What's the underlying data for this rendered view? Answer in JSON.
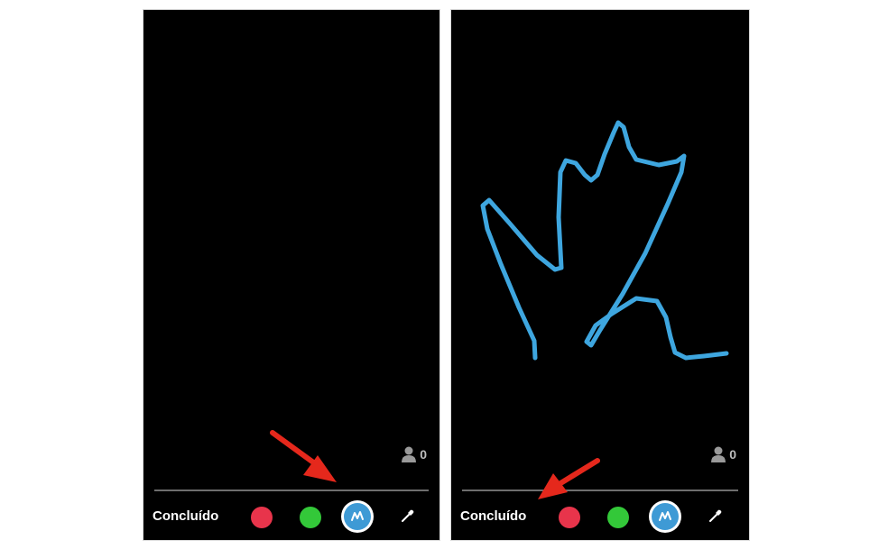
{
  "colors": {
    "background": "#000000",
    "red_color": "#e8344b",
    "green_color": "#33c839",
    "pen_blue": "#3e9ad5",
    "drawing_stroke": "#3ea6df",
    "annotation_arrow": "#e5281c"
  },
  "left_screen": {
    "viewer_icon": "person-icon",
    "viewer_count": "0",
    "done_label": "Concluído",
    "tools": [
      "red-color",
      "green-color",
      "pen-icon",
      "eyedropper-icon"
    ]
  },
  "right_screen": {
    "viewer_icon": "person-icon",
    "viewer_count": "0",
    "done_label": "Concluído",
    "tools": [
      "red-color",
      "green-color",
      "pen-icon",
      "eyedropper-icon"
    ],
    "drawing": "freehand-blue-stroke"
  },
  "annotations": [
    "arrow-to-pen-button",
    "arrow-to-done-button"
  ]
}
